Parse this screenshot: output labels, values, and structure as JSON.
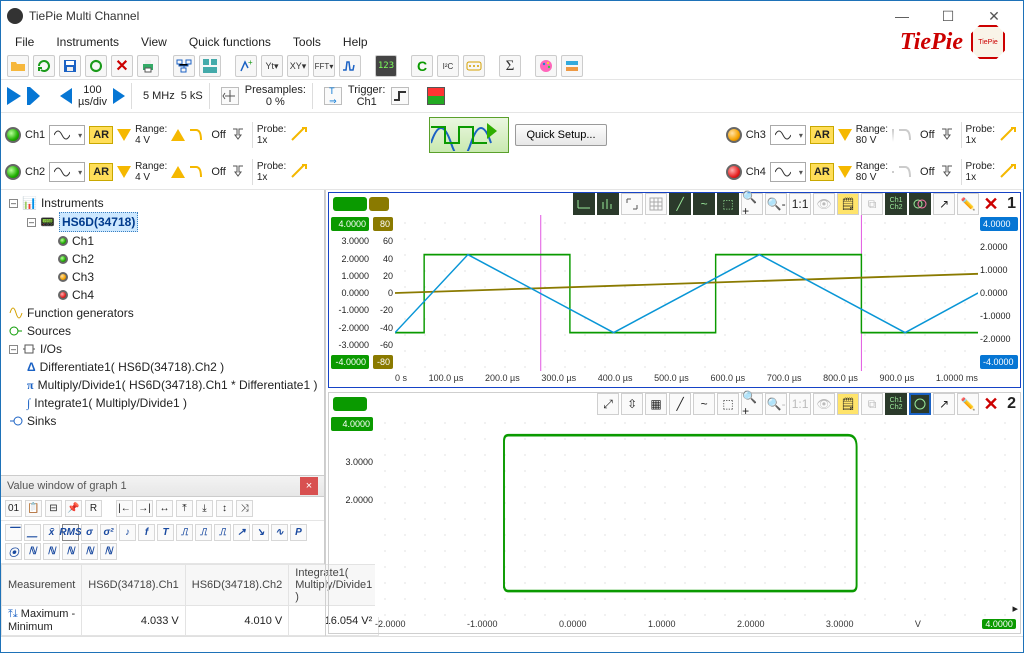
{
  "window": {
    "title": "TiePie Multi Channel"
  },
  "menu": [
    "File",
    "Instruments",
    "View",
    "Quick functions",
    "Tools",
    "Help"
  ],
  "brand": {
    "text": "TiePie",
    "badge": "TiePie"
  },
  "timebase": {
    "value": "100",
    "unit": "µs/div",
    "sample_rate": "5 MHz",
    "record": "5 kS",
    "presamples_label": "Presamples:",
    "presamples_value": "0 %",
    "trigger_label": "Trigger:",
    "trigger_source": "Ch1"
  },
  "channels": [
    {
      "name": "Ch1",
      "led": "green",
      "coupling": "AR",
      "range_label": "Range:",
      "range_value": "4 V",
      "off": "Off",
      "probe_label": "Probe:",
      "probe_value": "1x"
    },
    {
      "name": "Ch2",
      "led": "green",
      "coupling": "AR",
      "range_label": "Range:",
      "range_value": "4 V",
      "off": "Off",
      "probe_label": "Probe:",
      "probe_value": "1x"
    },
    {
      "name": "Ch3",
      "led": "amb",
      "coupling": "AR",
      "range_label": "Range:",
      "range_value": "80 V",
      "off": "Off",
      "probe_label": "Probe:",
      "probe_value": "1x"
    },
    {
      "name": "Ch4",
      "led": "red",
      "coupling": "AR",
      "range_label": "Range:",
      "range_value": "80 V",
      "off": "Off",
      "probe_label": "Probe:",
      "probe_value": "1x"
    }
  ],
  "quick_setup": "Quick Setup...",
  "tree": {
    "root_instruments": "Instruments",
    "device": "HS6D(34718)",
    "ch": [
      "Ch1",
      "Ch2",
      "Ch3",
      "Ch4"
    ],
    "fg": "Function generators",
    "sources": "Sources",
    "ios": "I/Os",
    "io_items": [
      "Differentiate1( HS6D(34718).Ch2 )",
      "Multiply/Divide1( HS6D(34718).Ch1 * Differentiate1 )",
      "Integrate1( Multiply/Divide1 )"
    ],
    "sinks": "Sinks"
  },
  "value_window": {
    "title": "Value window of graph 1",
    "headers": [
      "Measurement",
      "HS6D(34718).Ch1",
      "HS6D(34718).Ch2",
      "Integrate1( Multiply/Divide1 )"
    ],
    "row_label": "Maximum - Minimum",
    "row_vals": [
      "4.033 V",
      "4.010 V",
      "16.054 V²"
    ]
  },
  "graph1": {
    "index": "1",
    "y_left": [
      "4.0000",
      "3.0000",
      "2.0000",
      "1.0000",
      "0.0000",
      "-1.0000",
      "-2.0000",
      "-3.0000",
      "-4.0000"
    ],
    "y_left2": [
      "80",
      "60",
      "40",
      "20",
      "0",
      "-20",
      "-40",
      "-60",
      "-80"
    ],
    "y_right": [
      "4.0000",
      "2.0000",
      "1.0000",
      "0.0000",
      "-1.0000",
      "-2.0000",
      "-4.0000"
    ],
    "x": [
      "0 s",
      "100.0 µs",
      "200.0 µs",
      "300.0 µs",
      "400.0 µs",
      "500.0 µs",
      "600.0 µs",
      "700.0 µs",
      "800.0 µs",
      "900.0 µs",
      "1.0000 ms"
    ]
  },
  "graph2": {
    "index": "2",
    "y_left": [
      "4.0000",
      "3.0000",
      "2.0000"
    ],
    "x": [
      "-2.0000",
      "-1.0000",
      "0.0000",
      "1.0000",
      "2.0000",
      "3.0000",
      "V",
      "4.0000"
    ]
  },
  "chart_data": [
    {
      "type": "line",
      "title": "Graph 1",
      "x_unit": "µs",
      "x_range": [
        0,
        1000
      ],
      "series": [
        {
          "name": "HS6D(34718).Ch1 (V)",
          "color": "#0a9a00",
          "y_range": [
            -4,
            4
          ],
          "values": [
            [
              0,
              -2
            ],
            [
              50,
              -2
            ],
            [
              50,
              2
            ],
            [
              300,
              2
            ],
            [
              300,
              -2
            ],
            [
              550,
              -2
            ],
            [
              550,
              2
            ],
            [
              800,
              2
            ],
            [
              800,
              -2
            ],
            [
              1000,
              -2
            ]
          ]
        },
        {
          "name": "Differentiate1",
          "color": "#8a7a00",
          "y_range": [
            -80,
            80
          ],
          "values": [
            [
              0,
              0
            ],
            [
              1000,
              20
            ]
          ]
        },
        {
          "name": "HS6D(34718).Ch2 (V)",
          "color": "#0996d6",
          "y_range": [
            -4,
            4
          ],
          "values": [
            [
              0,
              -2
            ],
            [
              125,
              2
            ],
            [
              375,
              -2
            ],
            [
              625,
              2
            ],
            [
              875,
              -2
            ],
            [
              1000,
              0
            ]
          ]
        }
      ],
      "xlabels": [
        "0 s",
        "100.0 µs",
        "200.0 µs",
        "300.0 µs",
        "400.0 µs",
        "500.0 µs",
        "600.0 µs",
        "700.0 µs",
        "800.0 µs",
        "900.0 µs",
        "1.0000 ms"
      ]
    },
    {
      "type": "line",
      "title": "Graph 2 (XY)",
      "x_range": [
        -2,
        4
      ],
      "y_range": [
        2,
        4
      ],
      "series": [
        {
          "name": "Integrate1(Multiply/Divide1)",
          "color": "#0a9a00",
          "values": [
            [
              -2,
              2.2
            ],
            [
              -2,
              4
            ],
            [
              3,
              4
            ],
            [
              3,
              2.2
            ],
            [
              -2,
              2.2
            ]
          ]
        }
      ],
      "xlabels": [
        "-2.0000",
        "-1.0000",
        "0.0000",
        "1.0000",
        "2.0000",
        "3.0000",
        "V",
        "4.0000"
      ]
    }
  ]
}
